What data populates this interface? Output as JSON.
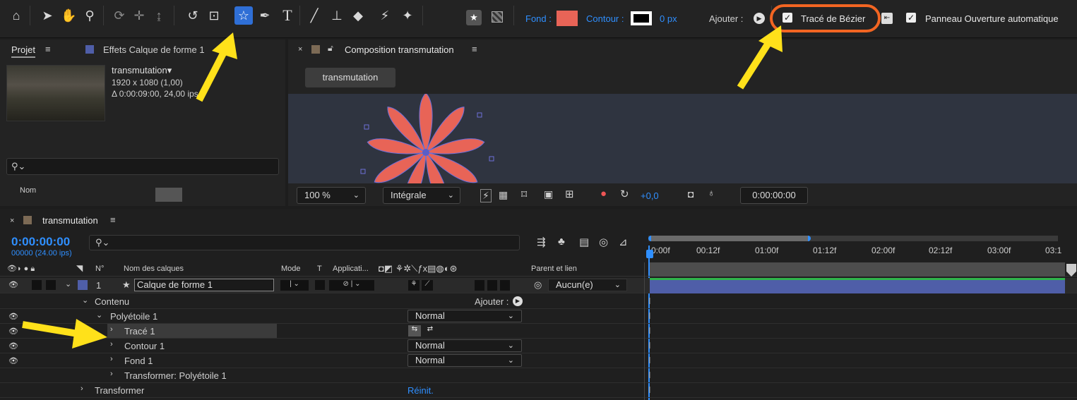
{
  "toolbar": {
    "tools": [
      "home-icon",
      "selection-arrow-icon",
      "hand-icon",
      "zoom-icon",
      "orbit-camera-icon",
      "pan-behind-icon",
      "dolly-icon",
      "rotate-icon",
      "anchor-point-icon",
      "star-shape-icon",
      "pen-icon",
      "text-icon",
      "brush-icon",
      "clone-stamp-icon",
      "eraser-icon",
      "roto-brush-icon",
      "puppet-pin-icon"
    ],
    "fill_label": "Fond :",
    "fill_color": "#e86457",
    "stroke_label": "Contour :",
    "stroke_width": "0 px",
    "add_label": "Ajouter :",
    "bezier_label": "Tracé de Bézier",
    "auto_open_label": "Panneau Ouverture automatique"
  },
  "project": {
    "tab": "Projet",
    "effects_tab": "Effets Calque de forme 1",
    "comp_name": "transmutation▾",
    "comp_size": "1920 x 1080 (1,00)",
    "comp_duration": "Δ 0:00:09:00, 24,00 ips",
    "col_name": "Nom"
  },
  "viewer": {
    "tab": "Composition transmutation",
    "comp_button": "transmutation",
    "zoom": "100 %",
    "resolution": "Intégrale",
    "exposure": "+0,0",
    "timecode": "0:00:00:00"
  },
  "timeline": {
    "tab": "transmutation",
    "current_time": "0:00:00:00",
    "frames": "00000 (24.00 ips)",
    "ruler": [
      "0:00f",
      "00:12f",
      "01:00f",
      "01:12f",
      "02:00f",
      "02:12f",
      "03:00f",
      "03:1"
    ],
    "headers": {
      "num": "N°",
      "layer_name": "Nom des calques",
      "mode": "Mode",
      "t": "T",
      "track_matte": "Applicati...",
      "parent": "Parent et lien"
    },
    "layer": {
      "num": "1",
      "name": "Calque de forme 1",
      "parent": "Aucun(e)"
    },
    "rows": {
      "content": "Contenu",
      "add": "Ajouter :",
      "polystar": "Polyétoile 1",
      "path": "Tracé 1",
      "stroke": "Contour 1",
      "fill": "Fond 1",
      "transform_polystar": "Transformer: Polyétoile 1",
      "transform": "Transformer",
      "reset": "Réinit.",
      "blend": "Normal"
    }
  },
  "colors": {
    "accent": "#2f8fff",
    "highlight": "#f26522",
    "arrow": "#ffe11a",
    "layer_bar": "#4f5ea8",
    "star": "#e86457"
  }
}
